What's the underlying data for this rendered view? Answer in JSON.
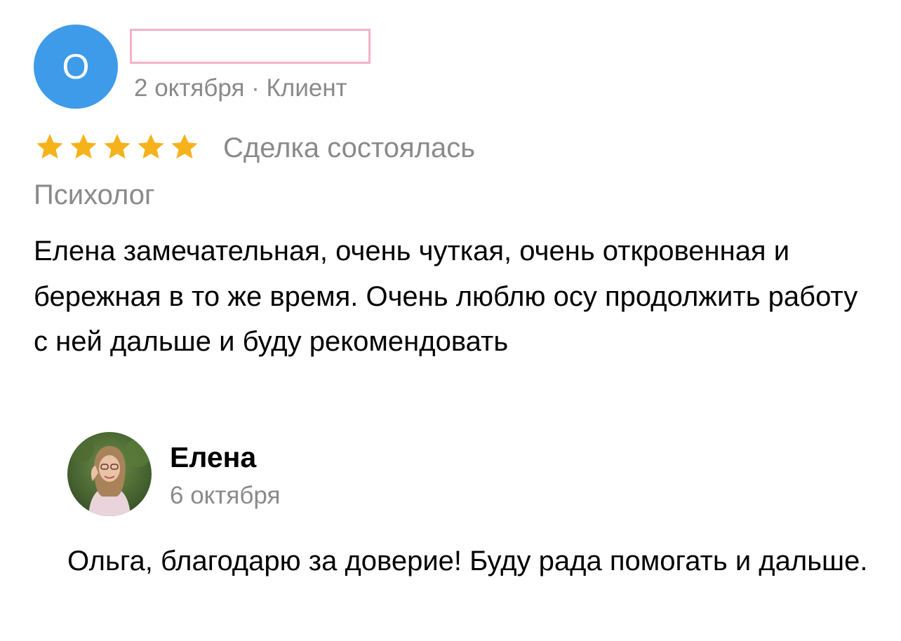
{
  "review": {
    "author_initial": "О",
    "date": "2 октября",
    "separator": " · ",
    "role": "Клиент",
    "rating": 5,
    "deal_status": "Сделка состоялась",
    "service": "Психолог",
    "text": "Елена замечательная, очень чуткая, очень откровенная и бережная в то же время. Очень люблю осу продолжить работу с ней дальше и буду рекомендовать"
  },
  "answer": {
    "author_name": "Елена",
    "date": "6 октября",
    "text": "Ольга, благодарю за доверие! Буду рада помогать и дальше."
  },
  "colors": {
    "avatar_bg": "#3d9be9",
    "star": "#f6b21a",
    "muted_text": "#8a8a8a",
    "redaction_border": "#f4b2c9"
  },
  "icons": {
    "star": "star-icon"
  }
}
